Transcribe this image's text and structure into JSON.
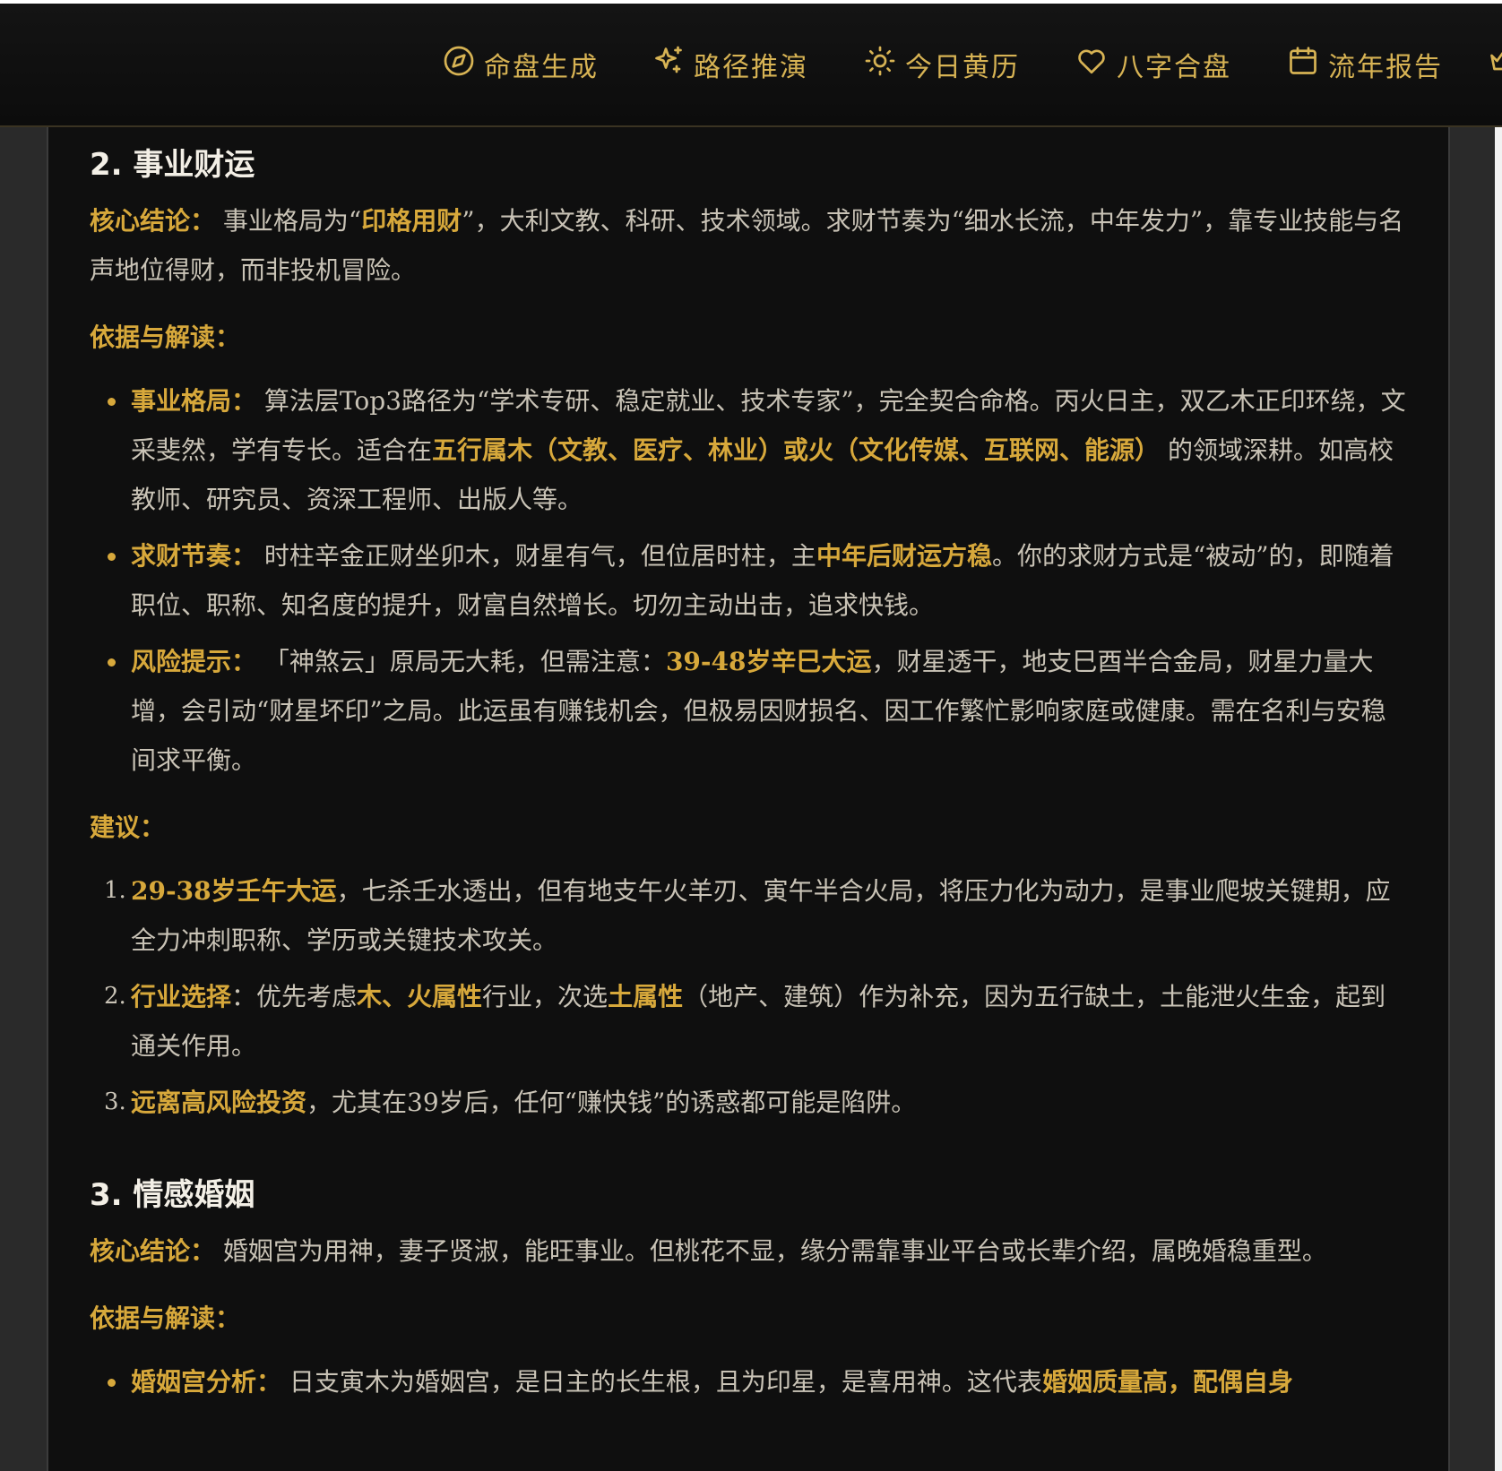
{
  "nav": {
    "items": [
      {
        "label": "命盘生成",
        "icon": "compass-icon"
      },
      {
        "label": "路径推演",
        "icon": "sparkles-icon"
      },
      {
        "label": "今日黄历",
        "icon": "sun-icon"
      },
      {
        "label": "八字合盘",
        "icon": "heart-icon"
      },
      {
        "label": "流年报告",
        "icon": "calendar-icon"
      }
    ]
  },
  "colors": {
    "accent": "#d7a83b",
    "nav_text": "#d7b354",
    "body_text": "#c9c3b6",
    "panel_bg": "#0f0f0f"
  },
  "section2": {
    "title": "2. 事业财运",
    "core_label": "核心结论：",
    "core_t1": "事业格局为“",
    "core_h1": "印格用财",
    "core_t2": "”，大利文教、科研、技术领域。求财节奏为“细水长流，中年发力”，靠专业技能与名声地位得财，而非投机冒险。",
    "basis_title": "依据与解读：",
    "b1_label": "事业格局：",
    "b1_t1": "算法层Top3路径为“学术专研、稳定就业、技术专家”，完全契合命格。丙火日主，双乙木正印环绕，文采斐然，学有专长。适合在",
    "b1_h1": "五行属木（文教、医疗、林业）或火（文化传媒、互联网、能源）",
    "b1_t2": "的领域深耕。如高校教师、研究员、资深工程师、出版人等。",
    "b2_label": "求财节奏：",
    "b2_t1": "时柱辛金正财坐卯木，财星有气，但位居时柱，主",
    "b2_h1": "中年后财运方稳",
    "b2_t2": "。你的求财方式是“被动”的，即随着职位、职称、知名度的提升，财富自然增长。切勿主动出击，追求快钱。",
    "b3_label": "风险提示：",
    "b3_t1": "「神煞云」原局无大耗，但需注意：",
    "b3_h1": "39-48岁辛巳大运",
    "b3_t2": "，财星透干，地支巳酉半合金局，财星力量大增，会引动“财星坏印”之局。此运虽有赚钱机会，但极易因财损名、因工作繁忙影响家庭或健康。需在名利与安稳间求平衡。",
    "advice_title": "建议：",
    "a1_num": "1.",
    "a1_h1": "29-38岁壬午大运",
    "a1_t1": "，七杀壬水透出，但有地支午火羊刃、寅午半合火局，将压力化为动力，是事业爬坡关键期，应全力冲刺职称、学历或关键技术攻关。",
    "a2_num": "2.",
    "a2_h1": "行业选择",
    "a2_t1": "：优先考虑",
    "a2_h2": "木、火属性",
    "a2_t2": "行业，次选",
    "a2_h3": "土属性",
    "a2_t3": "（地产、建筑）作为补充，因为五行缺土，土能泄火生金，起到通关作用。",
    "a3_num": "3.",
    "a3_h1": "远离高风险投资",
    "a3_t1": "，尤其在39岁后，任何“赚快钱”的诱惑都可能是陷阱。"
  },
  "section3": {
    "title": "3. 情感婚姻",
    "core_label": "核心结论：",
    "core_t1": "婚姻宫为用神，妻子贤淑，能旺事业。但桃花不显，缘分需靠事业平台或长辈介绍，属晚婚稳重型。",
    "basis_title": "依据与解读：",
    "b1_label": "婚姻宫分析：",
    "b1_t1": "日支寅木为婚姻宫，是日主的长生根，且为印星，是喜用神。这代表",
    "b1_h1": "婚姻质量高，配偶自身"
  }
}
